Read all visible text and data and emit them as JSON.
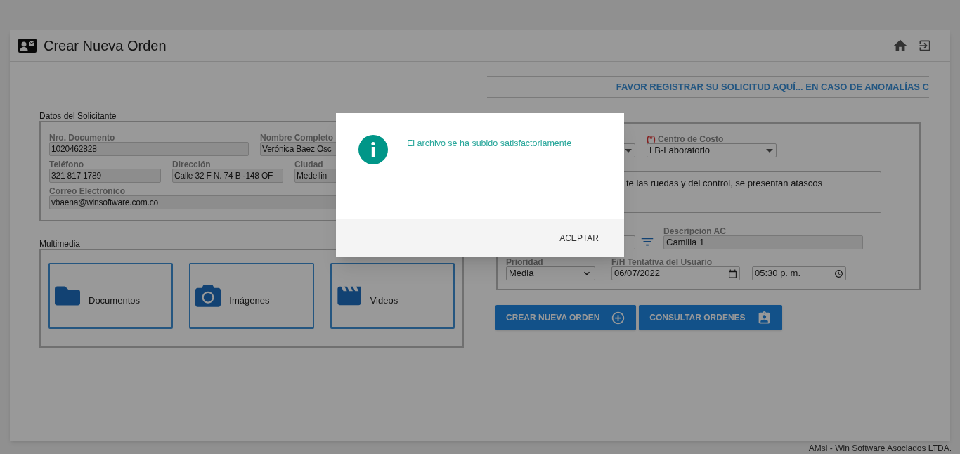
{
  "window": {
    "title": "Crear Nueva Orden"
  },
  "banner": "FAVOR REGISTRAR SU SOLICITUD AQUÍ... EN CASO DE ANOMALÍAS C",
  "solicitante": {
    "legend": "Datos del Solicitante",
    "fields": [
      {
        "label": "Nro. Documento",
        "value": "1020462828"
      },
      {
        "label": "Nombre Completo",
        "value": "Verónica Baez Osc"
      },
      {
        "label": "Teléfono",
        "value": "321 817 1789"
      },
      {
        "label": "Dirección",
        "value": "Calle 32 F N. 74 B -148 OF"
      },
      {
        "label": "Ciudad",
        "value": "Medellin"
      },
      {
        "label": "Correo Electrónico",
        "value": "vbaena@winsoftware.com.co"
      }
    ]
  },
  "multimedia": {
    "legend": "Multimedia",
    "items": [
      {
        "kind": "folder",
        "label": "Documentos"
      },
      {
        "kind": "camera",
        "label": "Imágenes"
      },
      {
        "kind": "clapper",
        "label": "Videos"
      }
    ]
  },
  "orden": {
    "cost_center": {
      "required_mark": "(*)",
      "label": "Centro de Costo",
      "value": "LB-Laboratorio"
    },
    "description": "te las ruedas y del control, se presentan atascos",
    "ac_description": {
      "label": "Descripcion AC",
      "value": "Camilla 1"
    },
    "priority": {
      "label": "Prioridad",
      "value": "Media"
    },
    "date": {
      "label": "F/H Tentativa del Usuario",
      "value": "06/07/2022"
    },
    "time": {
      "value": "05:30 p. m."
    }
  },
  "actions": [
    {
      "kind": "add",
      "label": "CREAR NUEVA ORDEN"
    },
    {
      "kind": "badge",
      "label": "CONSULTAR ORDENES"
    }
  ],
  "dialog": {
    "open": true,
    "message": "El archivo se ha subido satisfactoriamente",
    "button": "ACEPTAR"
  },
  "footer": "AMsi - Win Software Asociados LTDA."
}
